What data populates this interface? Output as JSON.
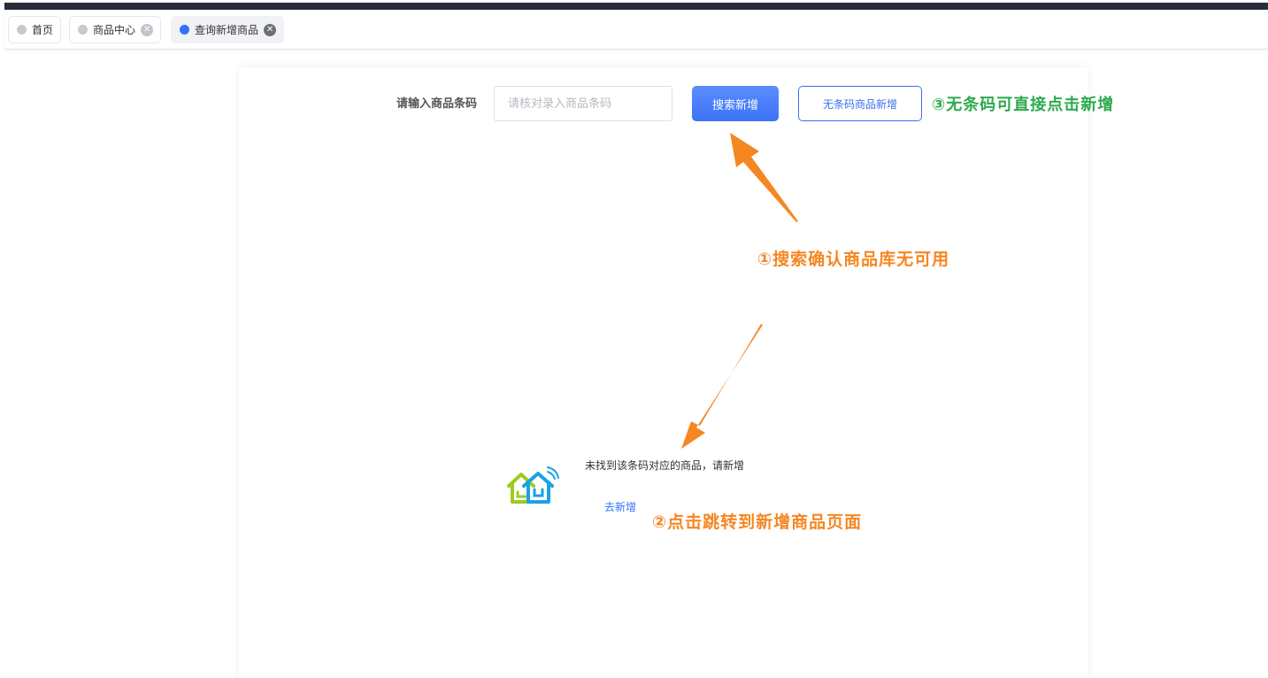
{
  "tabs": [
    {
      "label": "首页",
      "closable": false,
      "active": false
    },
    {
      "label": "商品中心",
      "closable": true,
      "active": false
    },
    {
      "label": "查询新增商品",
      "closable": true,
      "active": true
    }
  ],
  "search": {
    "label": "请输入商品条码",
    "value": "",
    "placeholder": "请核对录入商品条码",
    "search_button": "搜索新增",
    "no_barcode_button": "无条码商品新增"
  },
  "empty": {
    "message": "未找到该条码对应的商品，请新增",
    "add_link": "去新增"
  },
  "annotations": {
    "step1": "①搜索确认商品库无可用",
    "step2": "②点击跳转到新增商品页面",
    "step3": "③无条码可直接点击新增"
  },
  "colors": {
    "primary": "#3370ff",
    "arrow": "#f58722",
    "step3_text": "#2daa4e",
    "topbar": "#282d39"
  }
}
